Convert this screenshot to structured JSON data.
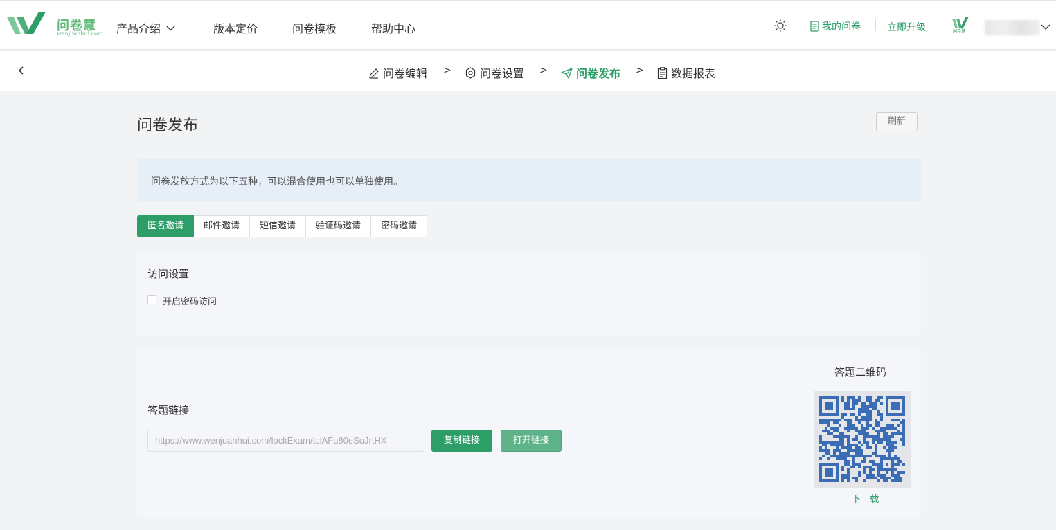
{
  "brand": {
    "name": "问卷慧",
    "domain": "wenjuanhui.com",
    "color": "#5fb878"
  },
  "nav": {
    "items": [
      "产品介绍",
      "版本定价",
      "问卷模板",
      "帮助中心"
    ],
    "my_survey": "我的问卷",
    "upgrade": "立即升级",
    "user_logo_text": "问卷慧"
  },
  "steps": {
    "items": [
      "问卷编辑",
      "问卷设置",
      "问卷发布",
      "数据报表"
    ],
    "active": "问卷发布",
    "separator": ">"
  },
  "page": {
    "title": "问卷发布",
    "refresh": "刷新",
    "notice": "问卷发放方式为以下五种，可以混合使用也可以单独使用。"
  },
  "tabs": [
    "匿名邀请",
    "邮件邀请",
    "短信邀请",
    "验证码邀请",
    "密码邀请"
  ],
  "access": {
    "title": "访问设置",
    "password_checkbox": "开启密码访问",
    "password_checked": false
  },
  "link": {
    "title": "答题链接",
    "url": "https://www.wenjuanhui.com/lockExam/tclAFu80eSoJrtHX",
    "copy": "复制链接",
    "open": "打开链接"
  },
  "qr": {
    "title": "答题二维码",
    "download": "下 载",
    "color": "#3a6db5"
  },
  "colors": {
    "accent": "#2e9e68",
    "notice_bg": "#e6eef7"
  }
}
